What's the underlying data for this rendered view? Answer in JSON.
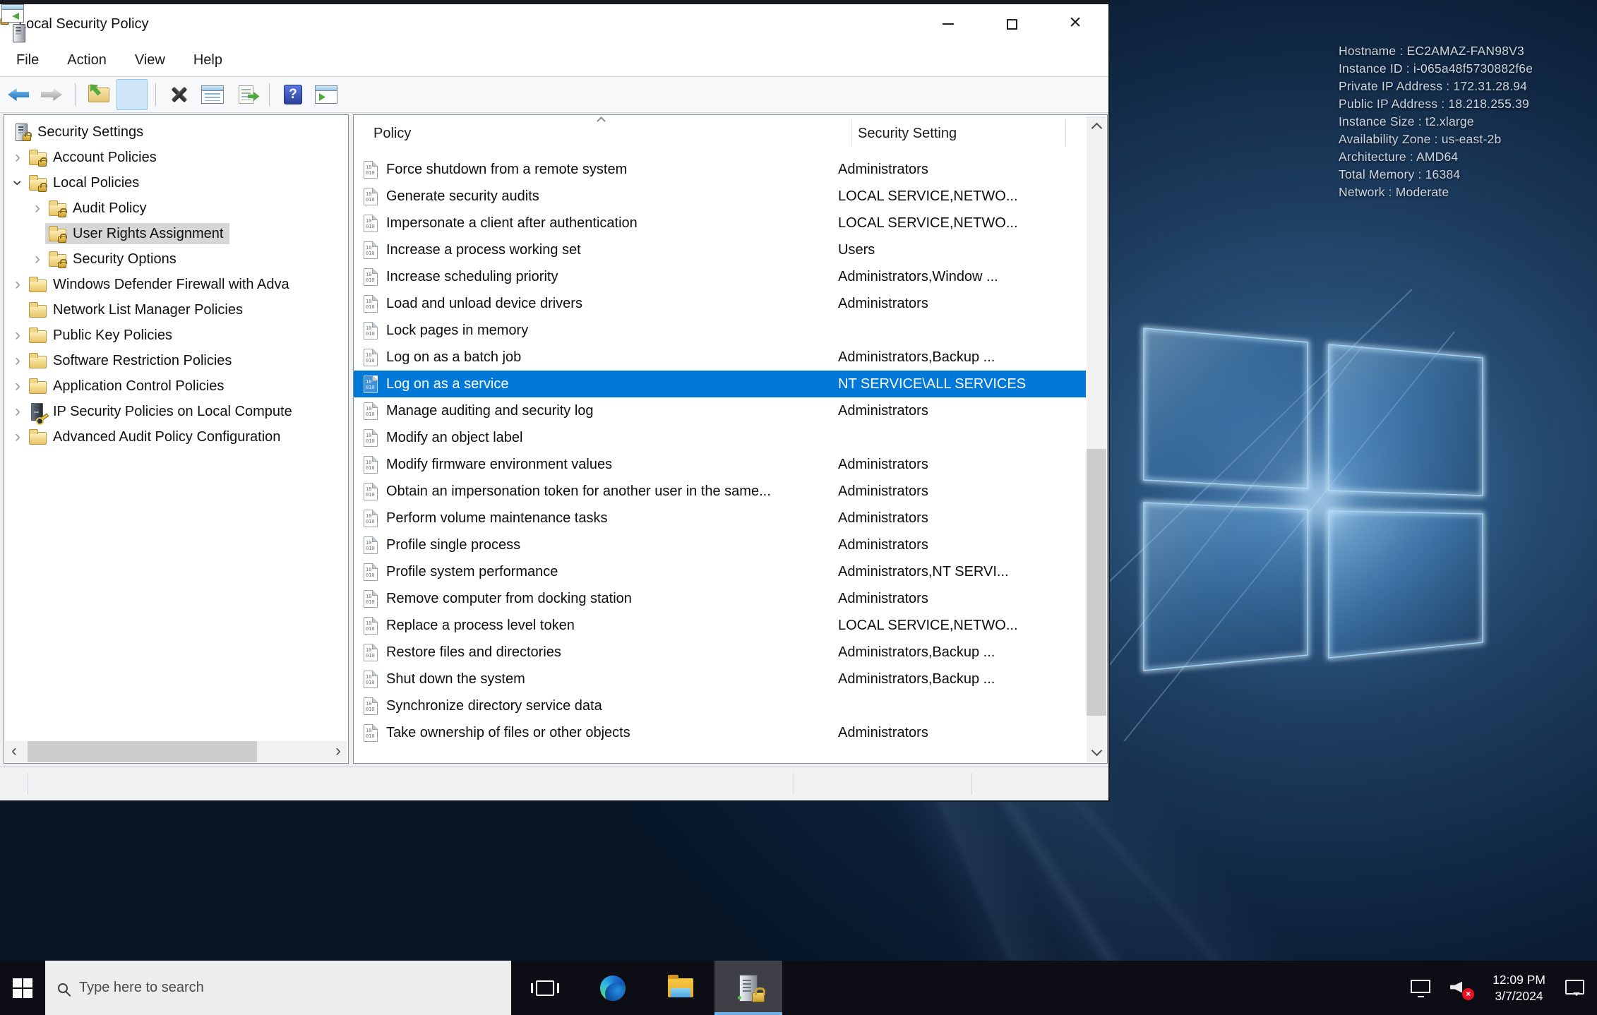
{
  "window": {
    "title": "Local Security Policy",
    "menu_items": [
      "File",
      "Action",
      "View",
      "Help"
    ],
    "toolbar_buttons": [
      "back",
      "forward",
      "up-one-level",
      "show-console-tree",
      "delete",
      "properties",
      "export-list",
      "help",
      "show-action-pane"
    ]
  },
  "tree": {
    "items": [
      {
        "label": "Security Settings",
        "level": 0,
        "icon": "computer-lock",
        "expand": "none",
        "selected": false
      },
      {
        "label": "Account Policies",
        "level": 1,
        "icon": "folder-lock",
        "expand": "collapsed",
        "selected": false
      },
      {
        "label": "Local Policies",
        "level": 1,
        "icon": "folder-lock",
        "expand": "expanded",
        "selected": false
      },
      {
        "label": "Audit Policy",
        "level": 2,
        "icon": "folder-lock",
        "expand": "collapsed",
        "selected": false
      },
      {
        "label": "User Rights Assignment",
        "level": 2,
        "icon": "folder-lock",
        "expand": "none",
        "selected": true
      },
      {
        "label": "Security Options",
        "level": 2,
        "icon": "folder-lock",
        "expand": "collapsed",
        "selected": false
      },
      {
        "label": "Windows Defender Firewall with Adva",
        "level": 1,
        "icon": "folder",
        "expand": "collapsed",
        "selected": false
      },
      {
        "label": "Network List Manager Policies",
        "level": 1,
        "icon": "folder",
        "expand": "none",
        "selected": false
      },
      {
        "label": "Public Key Policies",
        "level": 1,
        "icon": "folder",
        "expand": "collapsed",
        "selected": false
      },
      {
        "label": "Software Restriction Policies",
        "level": 1,
        "icon": "folder",
        "expand": "collapsed",
        "selected": false
      },
      {
        "label": "Application Control Policies",
        "level": 1,
        "icon": "folder",
        "expand": "collapsed",
        "selected": false
      },
      {
        "label": "IP Security Policies on Local Compute",
        "level": 1,
        "icon": "computer-key",
        "expand": "collapsed",
        "selected": false
      },
      {
        "label": "Advanced Audit Policy Configuration",
        "level": 1,
        "icon": "folder",
        "expand": "collapsed",
        "selected": false
      }
    ]
  },
  "list": {
    "columns": [
      "Policy",
      "Security Setting"
    ],
    "sorted_column": "Policy",
    "rows": [
      {
        "policy": "Force shutdown from a remote system",
        "setting": "Administrators",
        "selected": false
      },
      {
        "policy": "Generate security audits",
        "setting": "LOCAL SERVICE,NETWO...",
        "selected": false
      },
      {
        "policy": "Impersonate a client after authentication",
        "setting": "LOCAL SERVICE,NETWO...",
        "selected": false
      },
      {
        "policy": "Increase a process working set",
        "setting": "Users",
        "selected": false
      },
      {
        "policy": "Increase scheduling priority",
        "setting": "Administrators,Window ...",
        "selected": false
      },
      {
        "policy": "Load and unload device drivers",
        "setting": "Administrators",
        "selected": false
      },
      {
        "policy": "Lock pages in memory",
        "setting": "",
        "selected": false
      },
      {
        "policy": "Log on as a batch job",
        "setting": "Administrators,Backup ...",
        "selected": false
      },
      {
        "policy": "Log on as a service",
        "setting": "NT SERVICE\\ALL SERVICES",
        "selected": true
      },
      {
        "policy": "Manage auditing and security log",
        "setting": "Administrators",
        "selected": false
      },
      {
        "policy": "Modify an object label",
        "setting": "",
        "selected": false
      },
      {
        "policy": "Modify firmware environment values",
        "setting": "Administrators",
        "selected": false
      },
      {
        "policy": "Obtain an impersonation token for another user in the same...",
        "setting": "Administrators",
        "selected": false
      },
      {
        "policy": "Perform volume maintenance tasks",
        "setting": "Administrators",
        "selected": false
      },
      {
        "policy": "Profile single process",
        "setting": "Administrators",
        "selected": false
      },
      {
        "policy": "Profile system performance",
        "setting": "Administrators,NT SERVI...",
        "selected": false
      },
      {
        "policy": "Remove computer from docking station",
        "setting": "Administrators",
        "selected": false
      },
      {
        "policy": "Replace a process level token",
        "setting": "LOCAL SERVICE,NETWO...",
        "selected": false
      },
      {
        "policy": "Restore files and directories",
        "setting": "Administrators,Backup ...",
        "selected": false
      },
      {
        "policy": "Shut down the system",
        "setting": "Administrators,Backup ...",
        "selected": false
      },
      {
        "policy": "Synchronize directory service data",
        "setting": "",
        "selected": false
      },
      {
        "policy": "Take ownership of files or other objects",
        "setting": "Administrators",
        "selected": false
      }
    ]
  },
  "desktop": {
    "info_lines": [
      "Hostname : EC2AMAZ-FAN98V3",
      "Instance ID : i-065a48f5730882f6e",
      "Private IP Address : 172.31.28.94",
      "Public IP Address : 18.218.255.39",
      "Instance Size : t2.xlarge",
      "Availability Zone : us-east-2b",
      "Architecture : AMD64",
      "Total Memory : 16384",
      "Network : Moderate"
    ]
  },
  "taskbar": {
    "search_placeholder": "Type here to search",
    "clock_time": "12:09 PM",
    "clock_date": "3/7/2024"
  },
  "colors": {
    "selection_blue": "#0078d7",
    "tree_selection_gray": "#d6d6d6",
    "taskbar_black": "#0d0d15",
    "active_app_underline": "#6cb2e8"
  }
}
